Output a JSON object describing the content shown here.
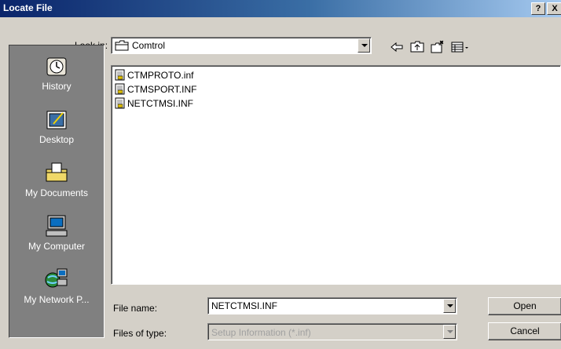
{
  "window": {
    "title": "Locate File",
    "help_label": "?",
    "close_label": "X"
  },
  "lookin": {
    "label": "Look in:",
    "value": "Comtrol"
  },
  "places": [
    {
      "label": "History",
      "icon": "history-icon"
    },
    {
      "label": "Desktop",
      "icon": "desktop-icon"
    },
    {
      "label": "My Documents",
      "icon": "my-documents-icon"
    },
    {
      "label": "My Computer",
      "icon": "my-computer-icon"
    },
    {
      "label": "My Network P...",
      "icon": "my-network-places-icon"
    }
  ],
  "files": [
    {
      "name": "CTMPROTO.inf",
      "icon": "setup-file-icon"
    },
    {
      "name": "CTMSPORT.INF",
      "icon": "setup-file-icon"
    },
    {
      "name": "NETCTMSI.INF",
      "icon": "setup-file-icon"
    }
  ],
  "filename": {
    "label": "File name:",
    "value": "NETCTMSI.INF"
  },
  "filetype": {
    "label": "Files of type:",
    "value": "Setup Information (*.inf)"
  },
  "buttons": {
    "open": "Open",
    "cancel": "Cancel"
  },
  "toolbar_icons": [
    "back-arrow-icon",
    "up-folder-icon",
    "new-folder-icon",
    "view-menu-icon"
  ],
  "colors": {
    "title_start": "#0a246a",
    "title_end": "#a6caf0",
    "face": "#d4d0c8",
    "places_bg": "#808080"
  }
}
